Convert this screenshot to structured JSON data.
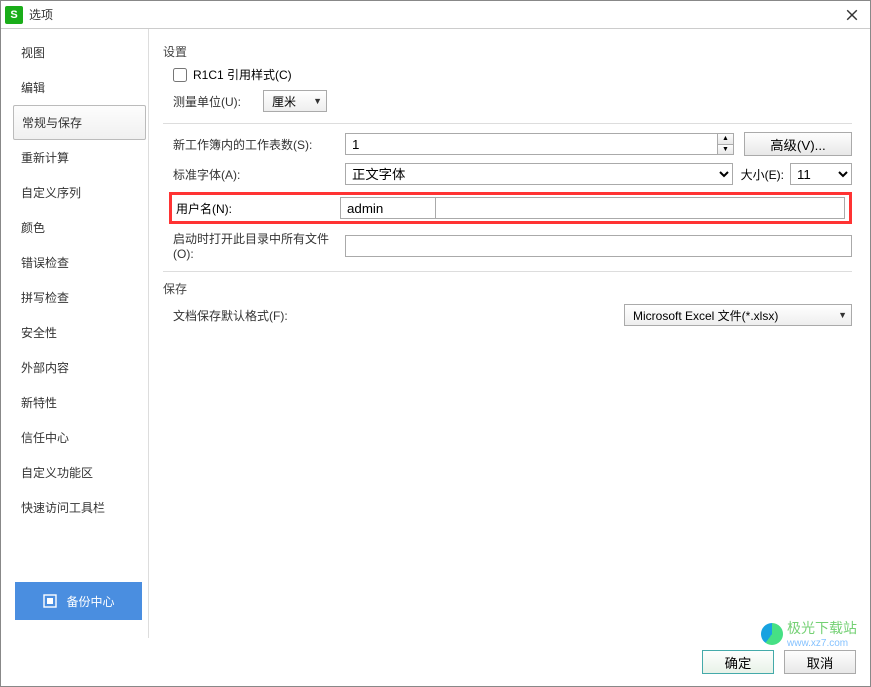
{
  "window": {
    "title": "选项"
  },
  "sidebar": {
    "items": [
      "视图",
      "编辑",
      "常规与保存",
      "重新计算",
      "自定义序列",
      "颜色",
      "错误检查",
      "拼写检查",
      "安全性",
      "外部内容",
      "新特性",
      "信任中心",
      "自定义功能区",
      "快速访问工具栏"
    ],
    "selected_index": 2,
    "backup_label": "备份中心"
  },
  "settings": {
    "title": "设置",
    "r1c1_label": "R1C1 引用样式(C)",
    "r1c1_checked": false,
    "measure_label": "测量单位(U):",
    "measure_value": "厘米",
    "sheets_label": "新工作簿内的工作表数(S):",
    "sheets_value": "1",
    "advanced_label": "高级(V)...",
    "font_label": "标准字体(A):",
    "font_value": "正文字体",
    "size_label": "大小(E):",
    "size_value": "11",
    "username_label": "用户名(N):",
    "username_value": "admin",
    "startup_label": "启动时打开此目录中所有文件(O):",
    "startup_value": ""
  },
  "save": {
    "title": "保存",
    "format_label": "文档保存默认格式(F):",
    "format_value": "Microsoft Excel 文件(*.xlsx)"
  },
  "buttons": {
    "ok": "确定",
    "cancel": "取消"
  },
  "watermark": {
    "text1": "极光下载站",
    "text2": "www.xz7.com"
  }
}
